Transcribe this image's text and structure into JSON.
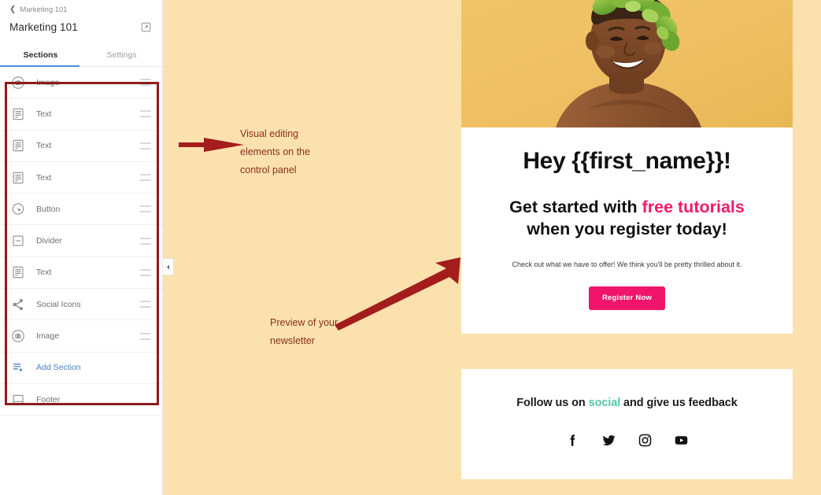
{
  "sidebar": {
    "breadcrumb": {
      "icon": "chevron-left-icon",
      "label": "Marketing 101"
    },
    "doc_title": "Marketing 101",
    "edit_icon": "external-link-edit-icon",
    "tabs": [
      {
        "label": "Sections",
        "active": true
      },
      {
        "label": "Settings",
        "active": false
      }
    ],
    "sections": [
      {
        "icon": "image-icon",
        "label": "Image",
        "handle": "drag-handle-icon"
      },
      {
        "icon": "text-icon",
        "label": "Text",
        "handle": "drag-handle-icon"
      },
      {
        "icon": "text-icon",
        "label": "Text",
        "handle": "drag-handle-icon"
      },
      {
        "icon": "text-icon",
        "label": "Text",
        "handle": "drag-handle-icon"
      },
      {
        "icon": "button-icon",
        "label": "Button",
        "handle": "drag-handle-icon"
      },
      {
        "icon": "divider-icon",
        "label": "Divider",
        "handle": "drag-handle-icon"
      },
      {
        "icon": "text-icon",
        "label": "Text",
        "handle": "drag-handle-icon"
      },
      {
        "icon": "social-icons-icon",
        "label": "Social Icons",
        "handle": "drag-handle-icon"
      },
      {
        "icon": "image-icon",
        "label": "Image",
        "handle": "drag-handle-icon"
      }
    ],
    "add_section": {
      "icon": "add-section-icon",
      "label": "Add Section"
    },
    "footer_item": {
      "icon": "footer-icon",
      "label": "Footer"
    },
    "collapse_handle": {
      "icon": "chevron-left-icon"
    }
  },
  "annotations": {
    "highlight_color": "#8E1C1C",
    "text_color": "#8A2F1E",
    "items": [
      {
        "text": "Visual editing\n elements on the\ncontrol panel",
        "arrow": "arrow-left"
      },
      {
        "text": "Preview of your\nnewsletter",
        "arrow": "arrow-up-right"
      }
    ]
  },
  "preview": {
    "hero": {
      "alt": "smiling woman wearing a green leaf crown on a yellow background",
      "background_color": "#EFC063"
    },
    "headline": "Hey {{first_name}}!",
    "subhead": {
      "part1": "Get started with ",
      "highlight1": "free tutorials",
      "part2": " when you register today!",
      "highlight_color": "#F01B69"
    },
    "body_copy": "Check out what we have to offer! We think you'll be pretty thrilled about it.",
    "cta_label": "Register Now",
    "cta_color": "#F0156B",
    "footer": {
      "text_part1": "Follow us on ",
      "text_highlight": "social",
      "text_part2": " and give us feedback",
      "highlight_color": "#58C4B0",
      "social_icons": [
        {
          "name": "facebook-icon"
        },
        {
          "name": "twitter-icon"
        },
        {
          "name": "instagram-icon"
        },
        {
          "name": "youtube-icon"
        }
      ]
    }
  },
  "canvas": {
    "background_color": "#FBE1AE"
  }
}
